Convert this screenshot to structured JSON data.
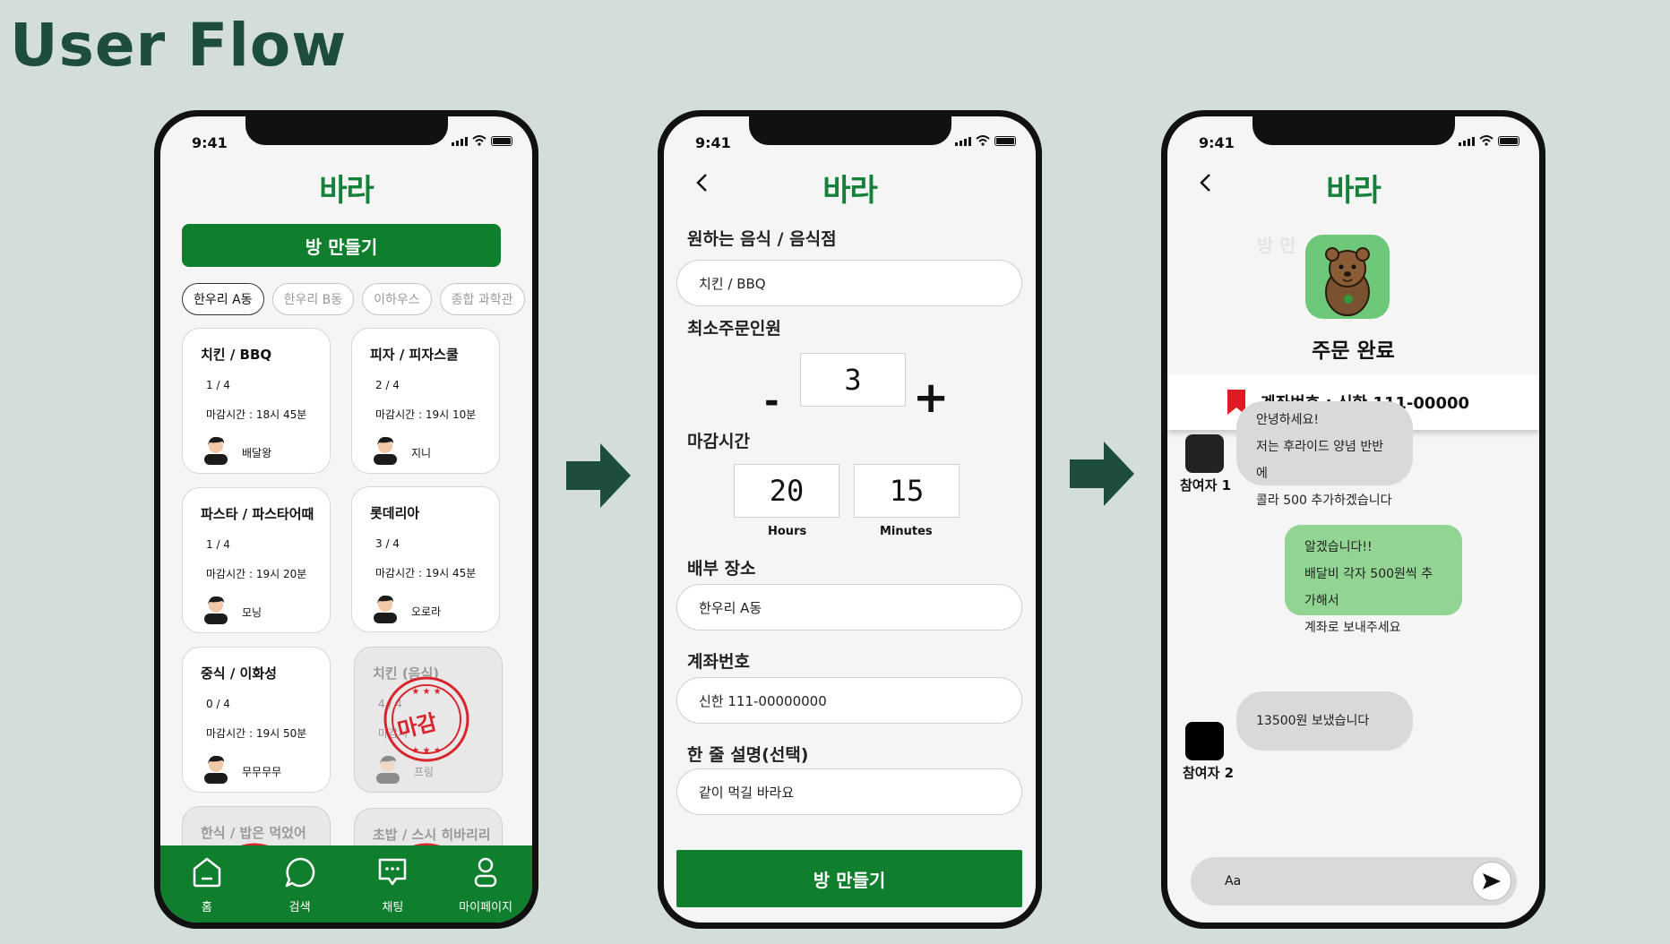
{
  "slide_title": "User Flow",
  "colors": {
    "brand_green": "#0f7f2d",
    "title_green": "#1d4d3b",
    "background": "#d3ddd9",
    "stamp_red": "#d8242c",
    "bubble_green": "#92d592",
    "bubble_gray": "#d9d9d9"
  },
  "phone1": {
    "time": "9:41",
    "logo": "바라",
    "make_room_button": "방 만들기",
    "filters": [
      "한우리 A동",
      "한우리 B동",
      "이하우스",
      "종합 과학관"
    ],
    "cards": [
      {
        "title": "치킨 / BBQ",
        "count": "1 / 4",
        "deadline": "마감시간 :  18시 45분",
        "name": "배달왕",
        "closed": false
      },
      {
        "title": "피자 / 피자스쿨",
        "count": "2 / 4",
        "deadline": "마감시간 : 19시 10분",
        "name": "지니",
        "closed": false
      },
      {
        "title": "파스타 / 파스타어때",
        "count": "1 / 4",
        "deadline": "마감시간 : 19시 20분",
        "name": "모닝",
        "closed": false
      },
      {
        "title": "롯데리아",
        "count": "3 / 4",
        "deadline": "마감시간 : 19시 45분",
        "name": "오로라",
        "closed": false
      },
      {
        "title": "중식 / 이화성",
        "count": "0 / 4",
        "deadline": "마감시간 : 19시 50분",
        "name": "무무무무",
        "closed": false
      },
      {
        "title": "치킨 (음식)",
        "count": "4 / 4",
        "deadline": "마감시",
        "name": "프링",
        "closed": true,
        "stamp": "마감"
      },
      {
        "title": "한식 / 밥은 먹었어",
        "closed": true
      },
      {
        "title": "초밥 / 스시 히바리리",
        "closed": true
      }
    ],
    "nav": [
      {
        "label": "홈",
        "icon": "home-icon"
      },
      {
        "label": "검색",
        "icon": "search-bubble-icon"
      },
      {
        "label": "채팅",
        "icon": "chat-icon"
      },
      {
        "label": "마이페이지",
        "icon": "profile-icon"
      }
    ]
  },
  "phone2": {
    "time": "9:41",
    "logo": "바라",
    "food_label": "원하는 음식 / 음식점",
    "food_value": "치킨 / BBQ",
    "min_people_label": "최소주문인원",
    "min_people_value": "3",
    "minus": "-",
    "plus": "+",
    "deadline_label": "마감시간",
    "hours_value": "20",
    "minutes_value": "15",
    "hours_unit": "Hours",
    "minutes_unit": "Minutes",
    "place_label": "배부 장소",
    "place_value": "한우리 A동",
    "account_label": "계좌번호",
    "account_value": "신한 111-00000000",
    "desc_label": "한 줄 설명(선택)",
    "desc_value": "같이 먹길 바라요",
    "submit": "방 만들기"
  },
  "phone3": {
    "time": "9:41",
    "logo": "바라",
    "ghost_text": "방 만",
    "order_done": "주문 완료",
    "account_info": "계좌번호 : 신한 111-00000",
    "messages": [
      {
        "sender": "참여자 1",
        "lines": [
          "안녕하세요!",
          "저는 후라이드 양념 반반에",
          "콜라 500 추가하겠습니다"
        ]
      },
      {
        "sender": "me",
        "lines": [
          "알겠습니다!!",
          "배달비 각자 500원씩 추가해서",
          "계좌로 보내주세요"
        ]
      },
      {
        "sender": "참여자 2",
        "lines": [
          "13500원 보냈습니다"
        ]
      }
    ],
    "input_placeholder": "Aa"
  }
}
